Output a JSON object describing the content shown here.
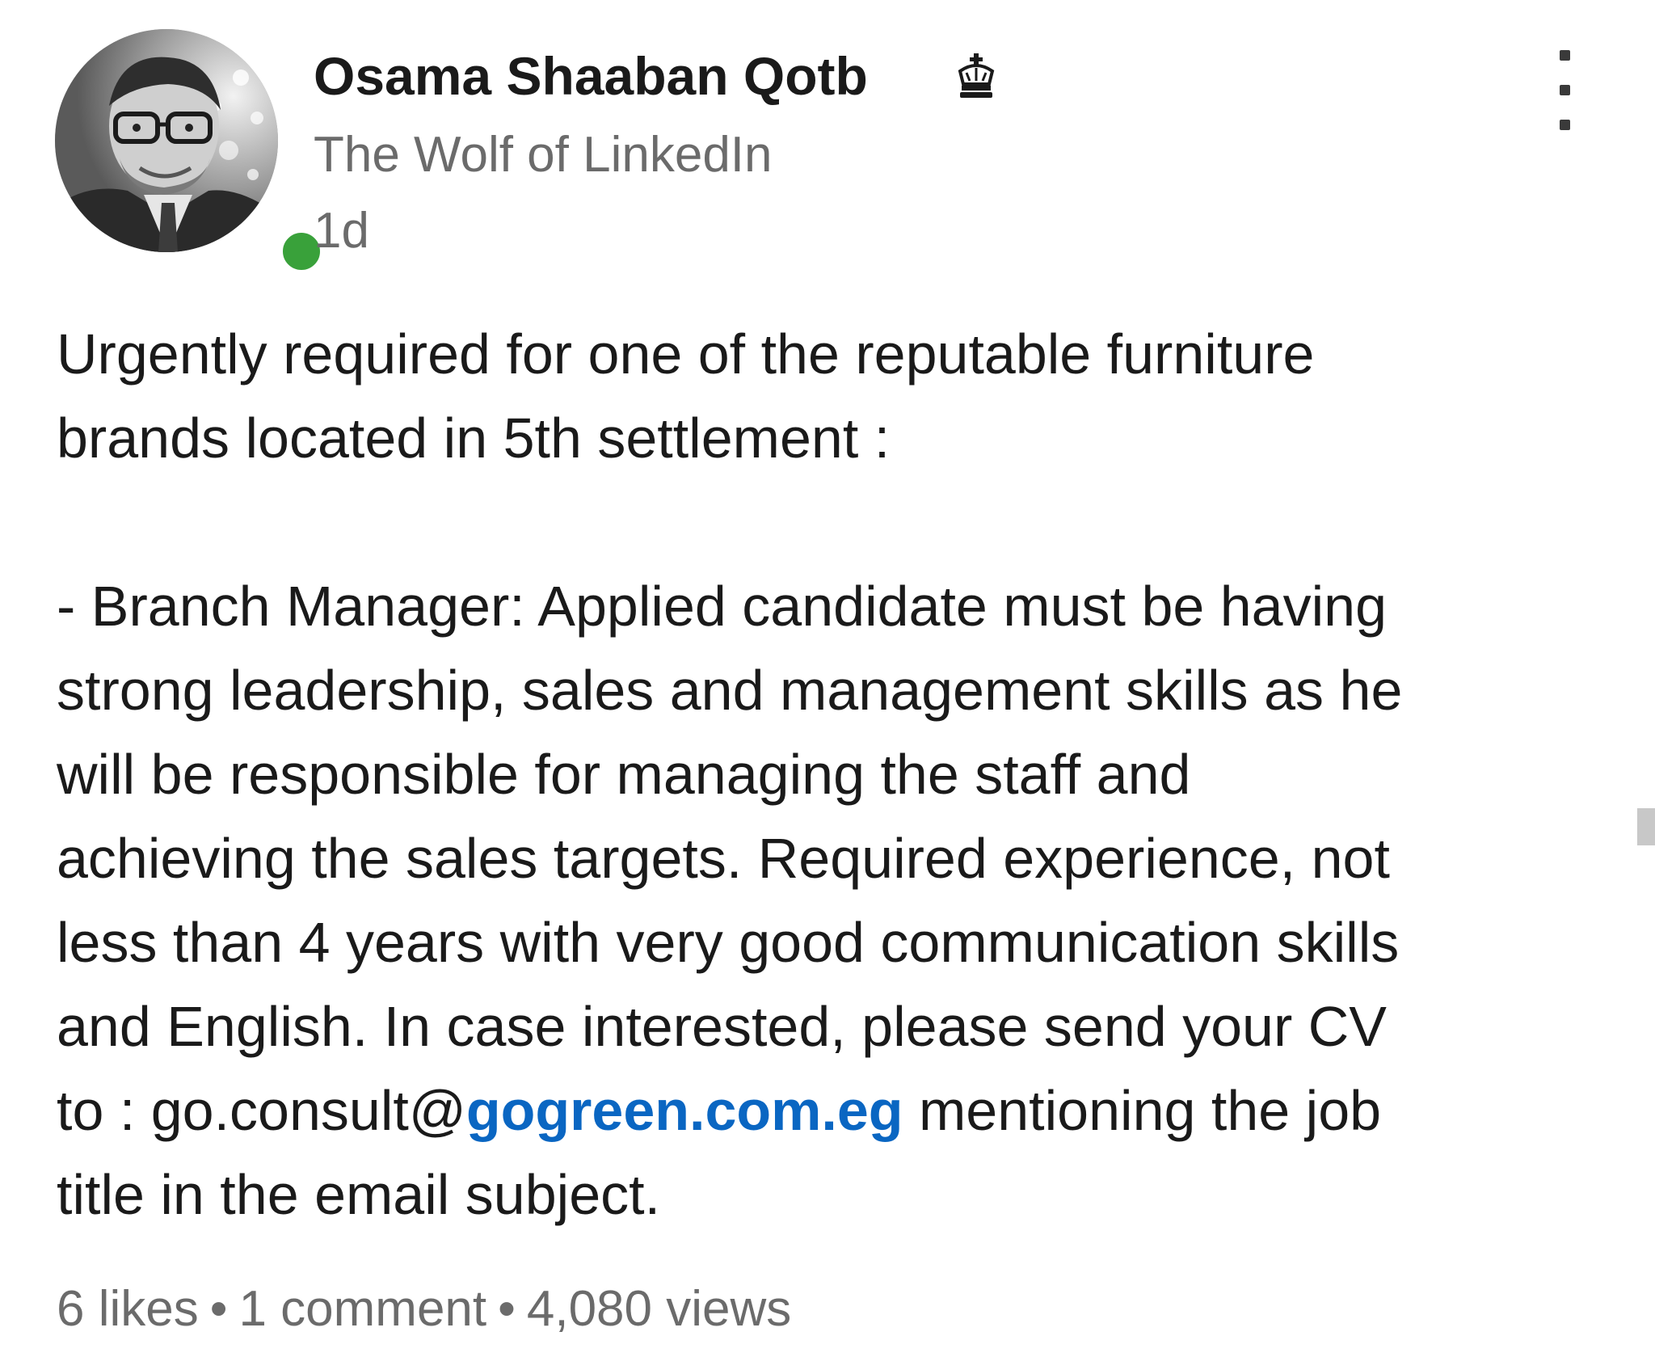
{
  "author": {
    "name": "Osama Shaaban Qotb",
    "badge_icon": "crown-icon",
    "headline": "The Wolf of LinkedIn",
    "posted": "1d",
    "online_status_color": "#39a13a"
  },
  "menu": {
    "icon": "more-vertical-icon"
  },
  "post": {
    "intro": "Urgently required for one of the reputable furniture\nbrands located in 5th settlement :",
    "body_before_link": "- Branch Manager: Applied candidate must be having\nstrong leadership, sales and management skills as he\nwill be responsible for managing the staff and\nachieving the sales targets. Required experience, not\nless than 4 years with very good communication skills\nand English. In case interested, please send your CV\nto : go.consult@",
    "link_text": "gogreen.com.eg",
    "body_after_link": " mentioning the job\ntitle in the email subject.",
    "link_color": "#0a66c2"
  },
  "stats": {
    "likes": "6 likes",
    "separator": "•",
    "comments": "1 comment",
    "views": "4,080 views"
  }
}
